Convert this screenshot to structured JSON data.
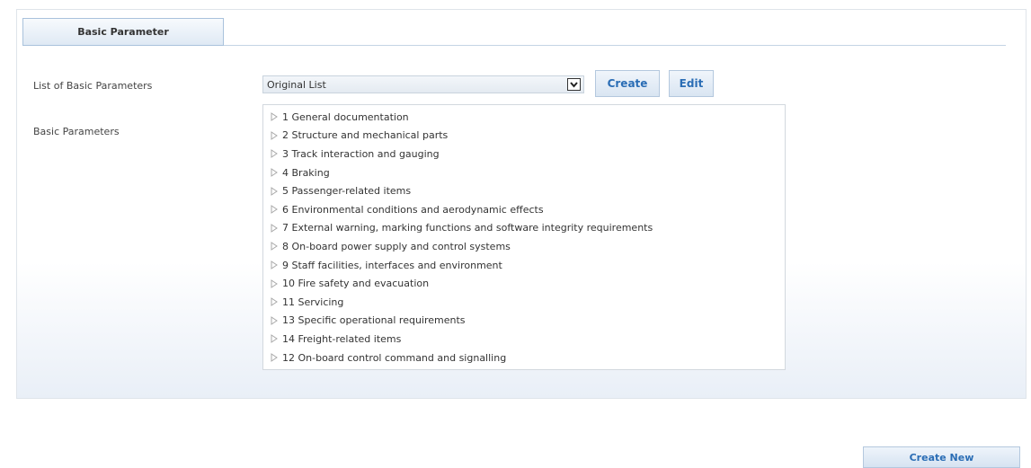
{
  "tab": {
    "title": "Basic Parameter"
  },
  "form": {
    "list_label": "List of Basic Parameters",
    "params_label": "Basic Parameters",
    "select_value": "Original List",
    "create_label": "Create",
    "edit_label": "Edit"
  },
  "tree": {
    "items": [
      {
        "label": "1 General documentation"
      },
      {
        "label": "2 Structure and mechanical parts"
      },
      {
        "label": "3 Track interaction and gauging"
      },
      {
        "label": "4 Braking"
      },
      {
        "label": "5 Passenger-related items"
      },
      {
        "label": "6 Environmental conditions and aerodynamic effects"
      },
      {
        "label": "7 External warning, marking functions and software integrity requirements"
      },
      {
        "label": "8 On-board power supply and control systems"
      },
      {
        "label": "9 Staff facilities, interfaces and environment"
      },
      {
        "label": "10 Fire safety and evacuation"
      },
      {
        "label": "11 Servicing"
      },
      {
        "label": "13 Specific operational requirements"
      },
      {
        "label": "14 Freight-related items"
      },
      {
        "label": "12 On-board control command and signalling"
      }
    ]
  },
  "footer": {
    "create_new_label": "Create New"
  },
  "colors": {
    "accent": "#2a6db5",
    "border": "#b4c8de"
  },
  "icons": {
    "tree_toggle": "triangle-right-icon",
    "select_arrow": "chevron-down-icon"
  }
}
